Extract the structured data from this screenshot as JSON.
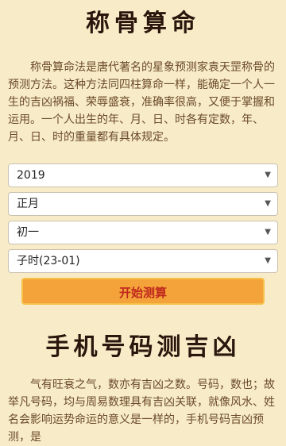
{
  "section1": {
    "title": "称骨算命",
    "intro": "称骨算命法是唐代著名的星象预测家袁天罡称骨的预测方法。这种方法同四柱算命一样，能确定一个人一生的吉凶祸福、荣辱盛衰，准确率很高，又便于掌握和运用。一个人出生的年、月、日、时各有定数，年、月、日、时的重量都有具体规定。"
  },
  "form": {
    "year": "2019",
    "month": "正月",
    "day": "初一",
    "hour": "子时(23-01)",
    "submit_label": "开始测算"
  },
  "section2": {
    "title": "手机号码测吉凶",
    "intro": "气有旺衰之气，数亦有吉凶之数。号码，数也；故举凡号码，均与周易数理具有吉凶关联，就像风水、姓名会影响运势命运的意义是一样的，手机号码吉凶预测，是"
  },
  "icons": {
    "dropdown": "triangle-down"
  }
}
